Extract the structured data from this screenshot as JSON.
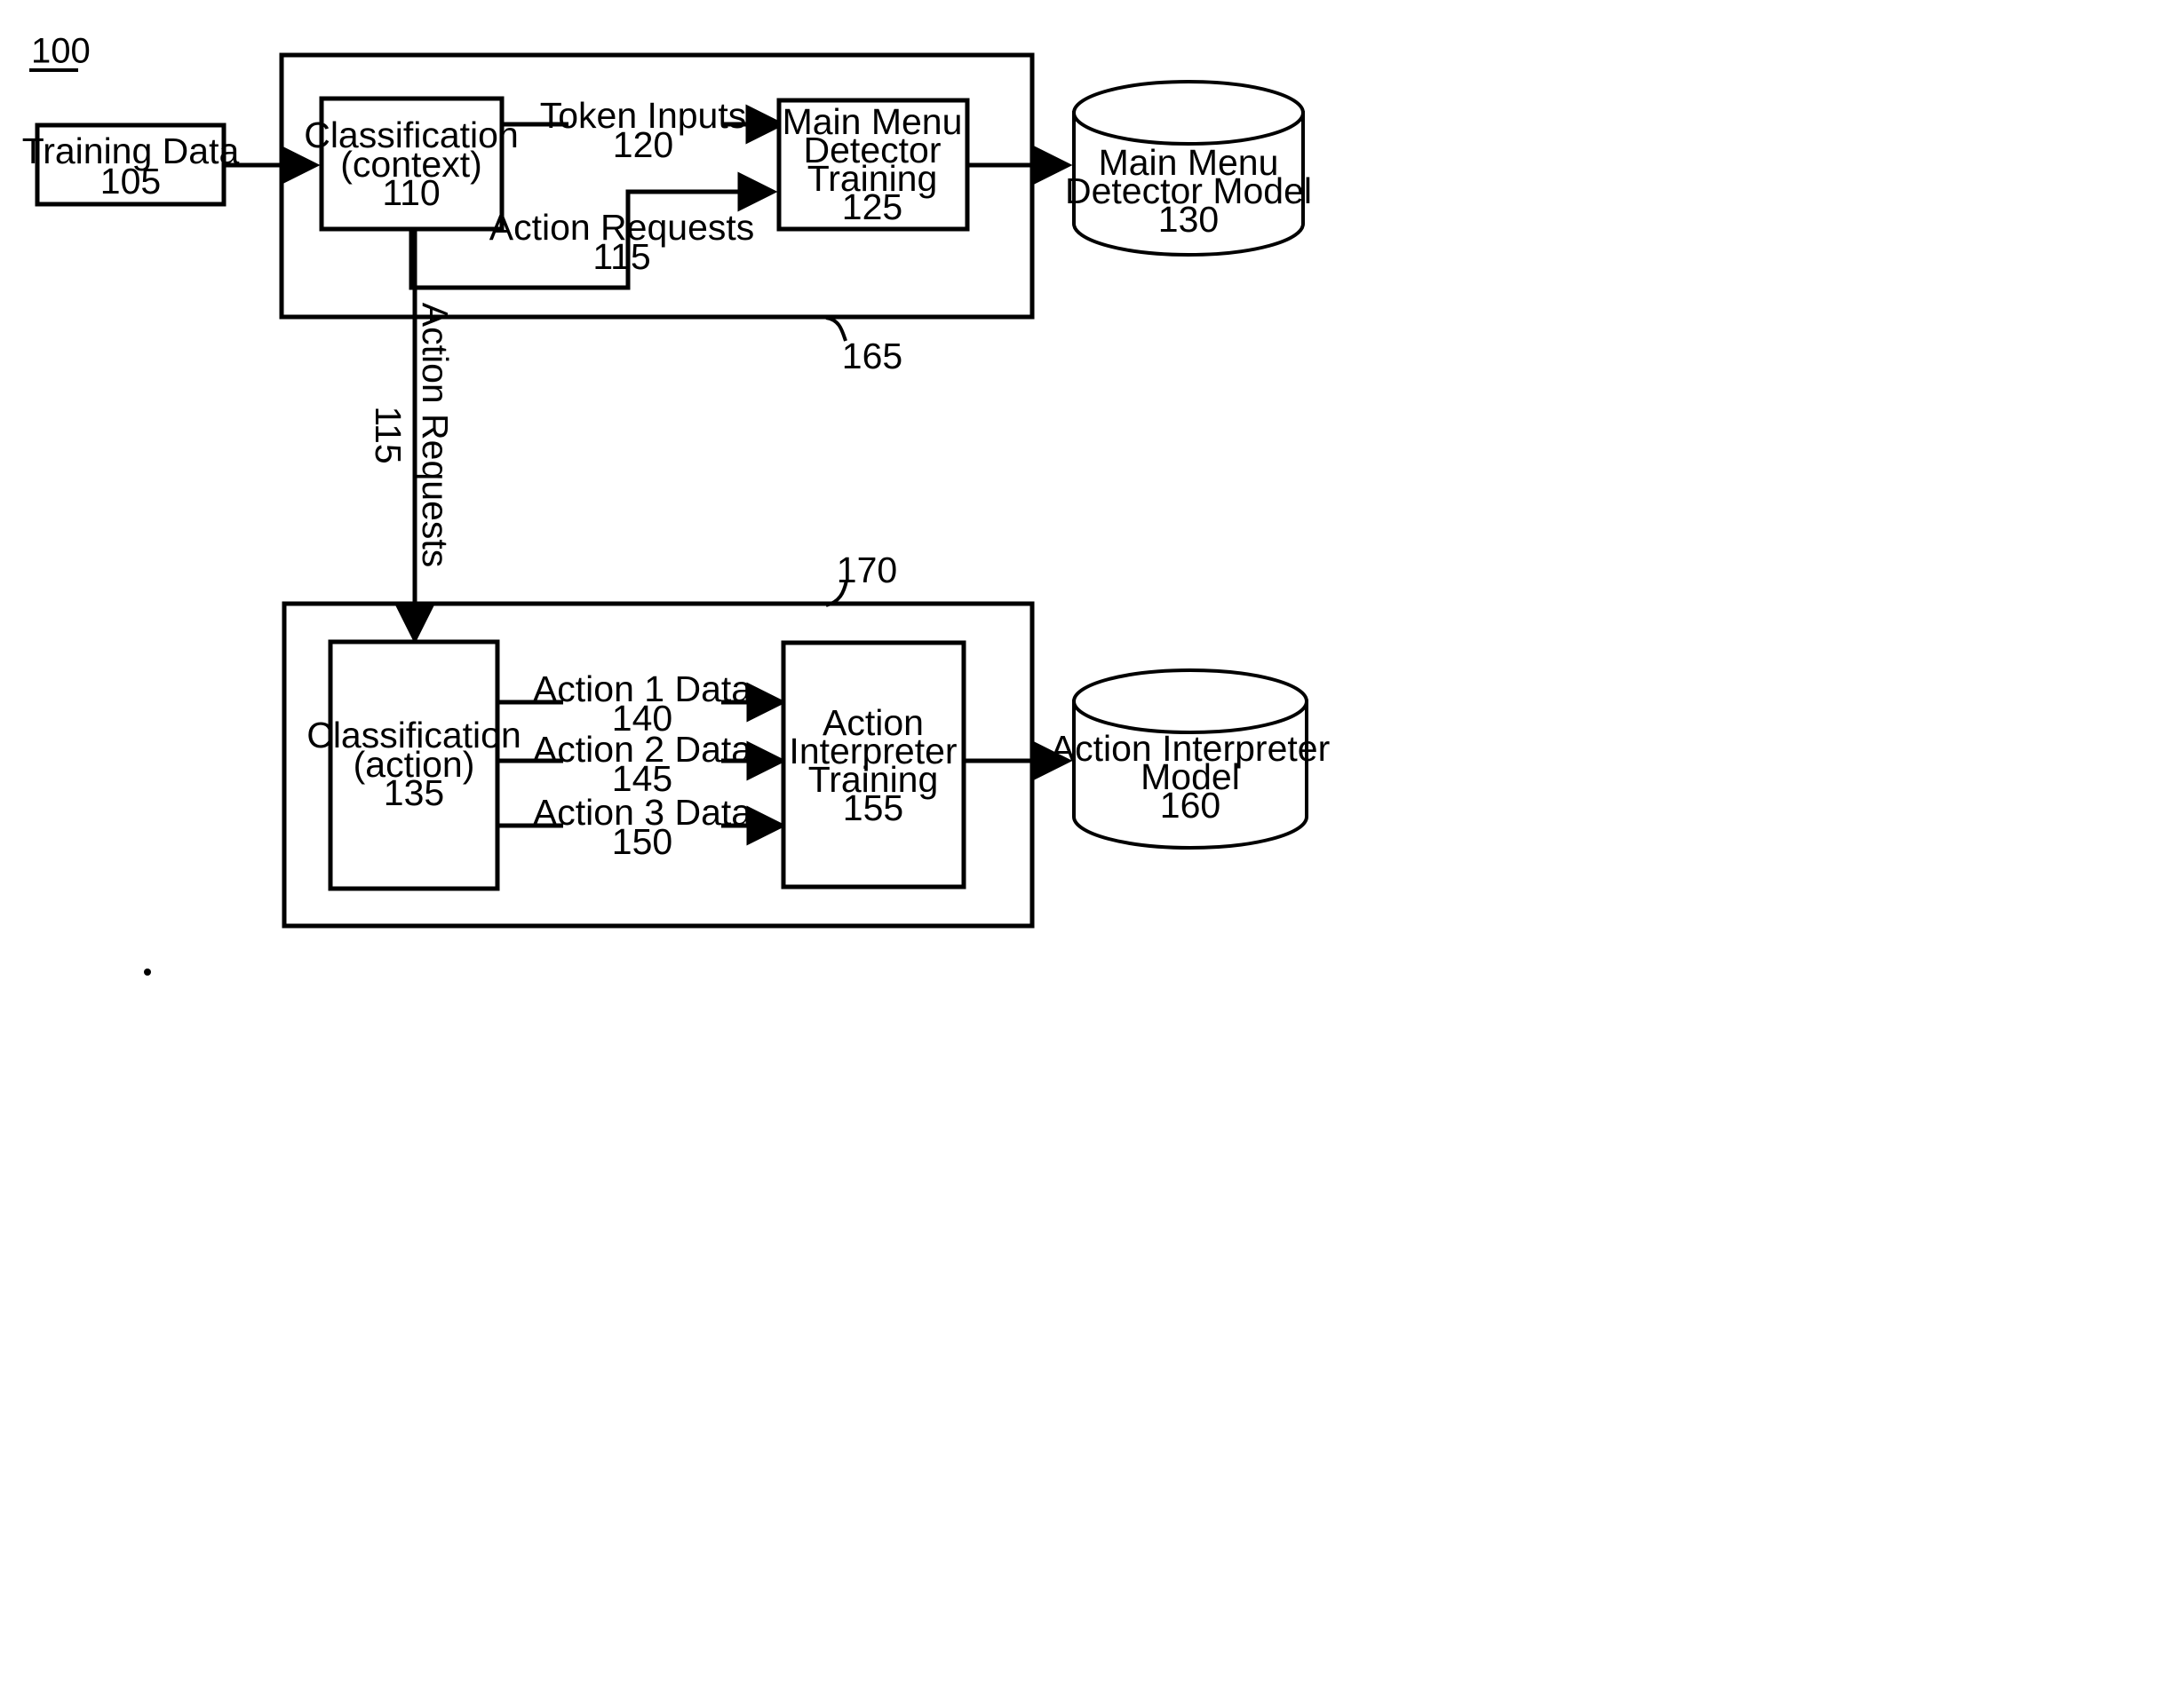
{
  "figure": {
    "number": "100",
    "underlined": true
  },
  "nodes": {
    "training_data": {
      "line1": "Training Data",
      "line2": "105"
    },
    "classification_context": {
      "line1": "Classification",
      "line2": "(context)",
      "line3": "110"
    },
    "main_menu_detector_training": {
      "line1": "Main Menu",
      "line2": "Detector",
      "line3": "Training",
      "line4": "125"
    },
    "main_menu_detector_model": {
      "line1": "Main Menu",
      "line2": "Detector Model",
      "line3": "130"
    },
    "classification_action": {
      "line1": "Classification",
      "line2": "(action)",
      "line3": "135"
    },
    "action_interpreter_training": {
      "line1": "Action",
      "line2": "Interpreter",
      "line3": "Training",
      "line4": "155"
    },
    "action_interpreter_model": {
      "line1": "Action Interpreter",
      "line2": "Model",
      "line3": "160"
    }
  },
  "edge_labels": {
    "token_inputs": {
      "line1": "Token Inputs",
      "line2": "120"
    },
    "action_requests_top": {
      "line1": "Action Requests",
      "line2": "115"
    },
    "action_requests_vertical": {
      "line1": "Action Requests",
      "line2": "115"
    },
    "action_1_data": {
      "line1": "Action 1 Data",
      "line2": "140"
    },
    "action_2_data": {
      "line1": "Action 2 Data",
      "line2": "145"
    },
    "action_3_data": {
      "line1": "Action 3 Data",
      "line2": "150"
    }
  },
  "containers": {
    "context_training_group": {
      "ref": "165"
    },
    "action_training_group": {
      "ref": "170"
    }
  },
  "colors": {
    "stroke": "#000000",
    "background": "#ffffff",
    "fill": "#ffffff"
  }
}
